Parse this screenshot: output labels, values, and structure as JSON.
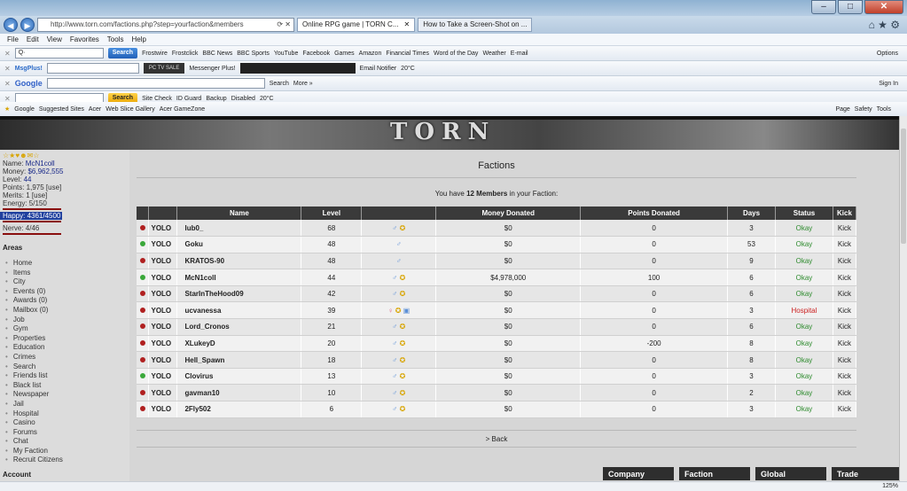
{
  "browser": {
    "url": "http://www.torn.com/factions.php?step=yourfaction&members",
    "tabs": [
      "Online RPG game | TORN C...",
      "How to Take a Screen-Shot on ..."
    ],
    "menu": [
      "File",
      "Edit",
      "View",
      "Favorites",
      "Tools",
      "Help"
    ],
    "toolbar1": [
      "Search",
      "Frostwire",
      "Frostclick",
      "BBC News",
      "BBC Sports",
      "YouTube",
      "Facebook",
      "Games",
      "Amazon",
      "Financial Times",
      "Word of the Day",
      "Weather",
      "E-mail",
      "Options"
    ],
    "toolbar2": [
      "MsgPlus!",
      "Messenger Plus!",
      "Email Notifier",
      "20°C"
    ],
    "toolbar3": [
      "Google",
      "Search",
      "More »",
      "Sign In"
    ],
    "toolbar4": [
      "Search",
      "Site Check",
      "ID Guard",
      "Backup",
      "Disabled",
      "20°C"
    ],
    "favorites": [
      "Google",
      "Suggested Sites",
      "Acer",
      "Web Slice Gallery",
      "Acer GameZone",
      "Page",
      "Safety",
      "Tools"
    ],
    "zoom": "125%"
  },
  "banner": {
    "logo": "TORN"
  },
  "player": {
    "name_label": "Name:",
    "name": "McN1coll",
    "money_label": "Money:",
    "money": "$6,962,555",
    "level_label": "Level:",
    "level": "44",
    "points": "Points: 1,975 [use]",
    "merits": "Merits: 1 [use]",
    "energy": "Energy: 5/150",
    "happy": "Happy: 4361/4500",
    "nerve": "Nerve: 4/46"
  },
  "areas_title": "Areas",
  "areas": [
    "Home",
    "Items",
    "City",
    "Events (0)",
    "Awards (0)",
    "Mailbox (0)",
    "Job",
    "Gym",
    "Properties",
    "Education",
    "Crimes",
    "Search",
    "Friends list",
    "Black list",
    "Newspaper",
    "Jail",
    "Hospital",
    "Casino",
    "Forums",
    "Chat",
    "My Faction",
    "Recruit Citizens"
  ],
  "account_title": "Account",
  "page": {
    "title": "Factions",
    "msg_pre": "You have ",
    "msg_count": "12 Members",
    "msg_post": " in your Faction:",
    "back": "> Back"
  },
  "columns": [
    "Name",
    "Level",
    "",
    "Money Donated",
    "Points Donated",
    "Days",
    "Status",
    "Kick"
  ],
  "members": [
    {
      "online": "red",
      "faction": "YOLO",
      "name": "lub0_",
      "level": "68",
      "icons": [
        "male",
        "star"
      ],
      "money": "$0",
      "points": "0",
      "days": "3",
      "status": "Okay",
      "kick": "Kick"
    },
    {
      "online": "green",
      "faction": "YOLO",
      "name": "Goku",
      "level": "48",
      "icons": [
        "male"
      ],
      "money": "$0",
      "points": "0",
      "days": "53",
      "status": "Okay",
      "kick": "Kick"
    },
    {
      "online": "red",
      "faction": "YOLO",
      "name": "KRATOS-90",
      "level": "48",
      "icons": [
        "male"
      ],
      "money": "$0",
      "points": "0",
      "days": "9",
      "status": "Okay",
      "kick": "Kick"
    },
    {
      "online": "green",
      "faction": "YOLO",
      "name": "McN1coll",
      "level": "44",
      "icons": [
        "male",
        "star"
      ],
      "money": "$4,978,000",
      "points": "100",
      "days": "6",
      "status": "Okay",
      "kick": "Kick"
    },
    {
      "online": "red",
      "faction": "YOLO",
      "name": "StarInTheHood09",
      "level": "42",
      "icons": [
        "male",
        "star"
      ],
      "money": "$0",
      "points": "0",
      "days": "6",
      "status": "Okay",
      "kick": "Kick"
    },
    {
      "online": "red",
      "faction": "YOLO",
      "name": "ucvanessa",
      "level": "39",
      "icons": [
        "female",
        "star",
        "box"
      ],
      "money": "$0",
      "points": "0",
      "days": "3",
      "status": "Hospital",
      "kick": "Kick"
    },
    {
      "online": "red",
      "faction": "YOLO",
      "name": "Lord_Cronos",
      "level": "21",
      "icons": [
        "male",
        "star"
      ],
      "money": "$0",
      "points": "0",
      "days": "6",
      "status": "Okay",
      "kick": "Kick"
    },
    {
      "online": "red",
      "faction": "YOLO",
      "name": "XLukeyD",
      "level": "20",
      "icons": [
        "male",
        "star"
      ],
      "money": "$0",
      "points": "-200",
      "days": "8",
      "status": "Okay",
      "kick": "Kick"
    },
    {
      "online": "red",
      "faction": "YOLO",
      "name": "Hell_Spawn",
      "level": "18",
      "icons": [
        "male",
        "star"
      ],
      "money": "$0",
      "points": "0",
      "days": "8",
      "status": "Okay",
      "kick": "Kick"
    },
    {
      "online": "green",
      "faction": "YOLO",
      "name": "Clovirus",
      "level": "13",
      "icons": [
        "male",
        "star"
      ],
      "money": "$0",
      "points": "0",
      "days": "3",
      "status": "Okay",
      "kick": "Kick"
    },
    {
      "online": "red",
      "faction": "YOLO",
      "name": "gavman10",
      "level": "10",
      "icons": [
        "male",
        "star"
      ],
      "money": "$0",
      "points": "0",
      "days": "2",
      "status": "Okay",
      "kick": "Kick"
    },
    {
      "online": "red",
      "faction": "YOLO",
      "name": "2Fly502",
      "level": "6",
      "icons": [
        "male",
        "star"
      ],
      "money": "$0",
      "points": "0",
      "days": "3",
      "status": "Okay",
      "kick": "Kick"
    }
  ],
  "bottom_tabs": [
    "Company",
    "Faction",
    "Global",
    "Trade"
  ],
  "colors": {
    "online_green": "#3aa83a",
    "online_red": "#b02020",
    "okay": "#2e8b2e",
    "hospital": "#cc2222"
  }
}
